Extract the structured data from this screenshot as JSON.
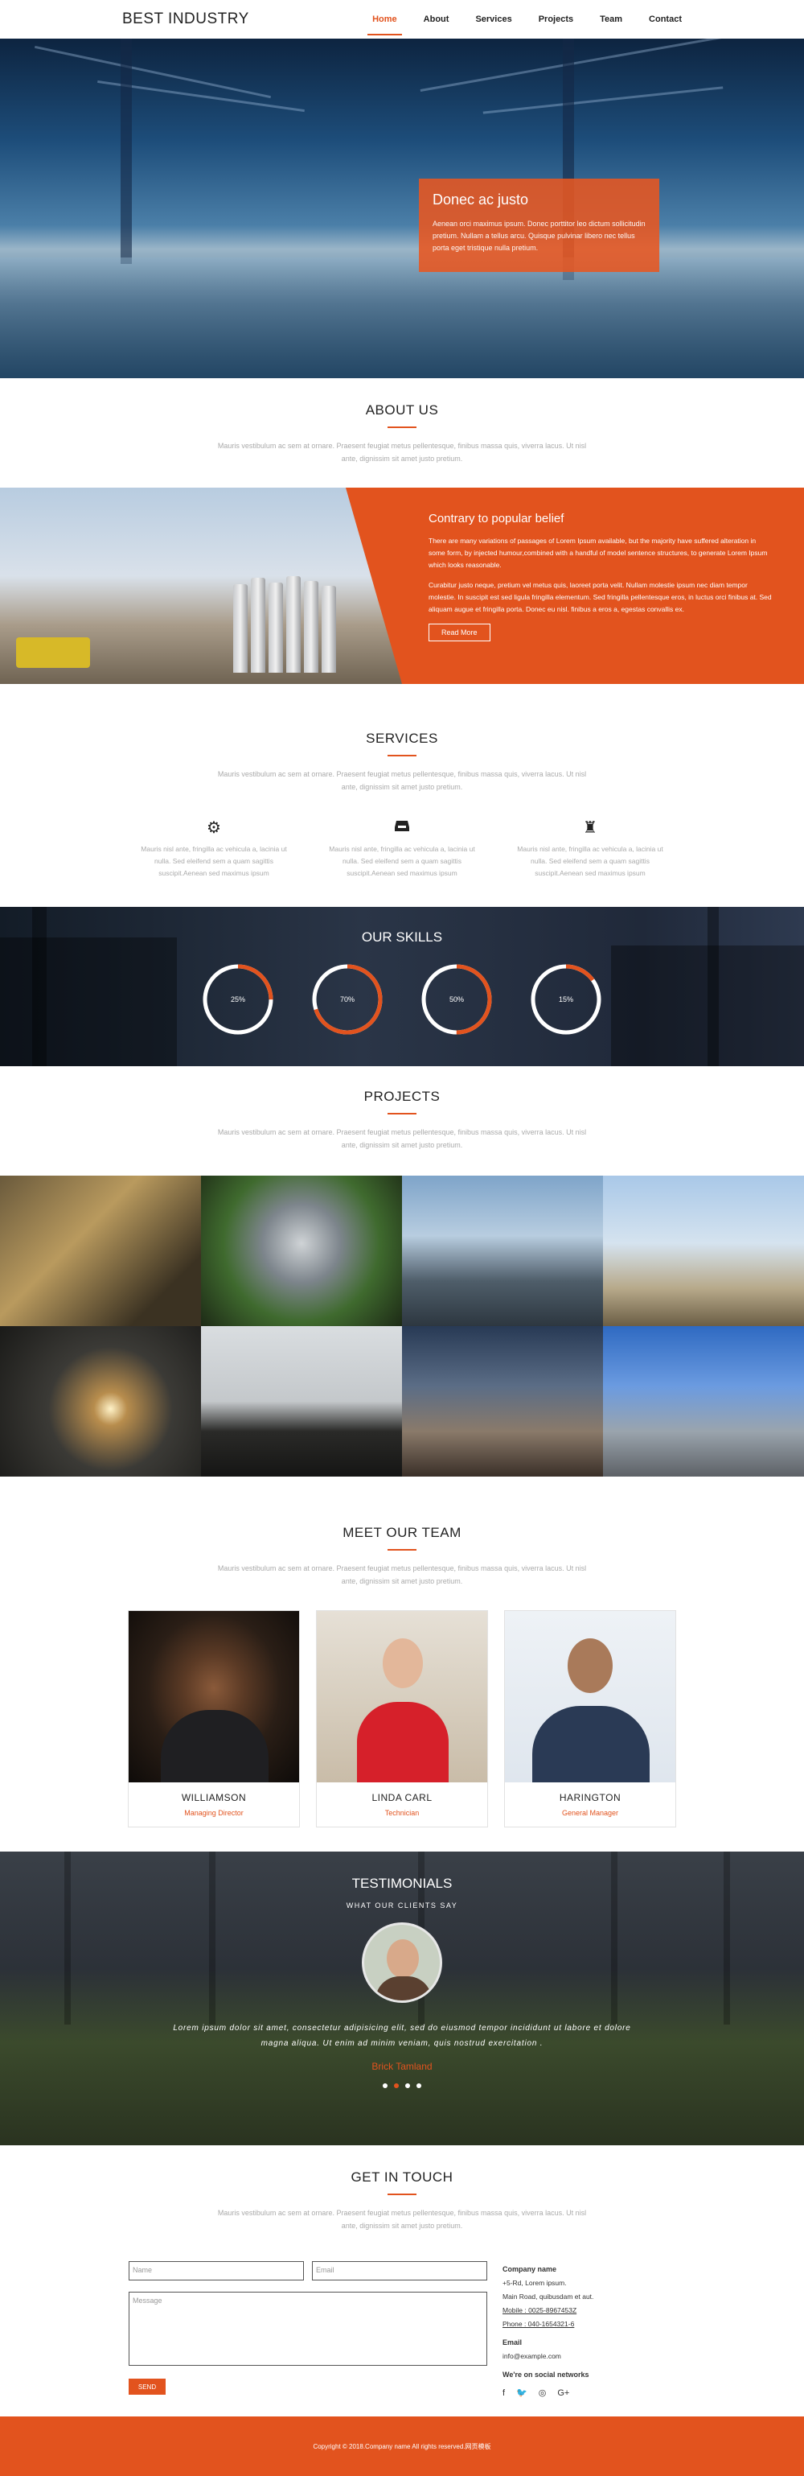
{
  "header": {
    "brand": "BEST INDUSTRY",
    "nav": [
      "Home",
      "About",
      "Services",
      "Projects",
      "Team",
      "Contact"
    ]
  },
  "hero": {
    "title": "Donec ac justo",
    "text": "Aenean orci maximus ipsum. Donec porttitor leo dictum sollicitudin pretium. Nullam a tellus arcu. Quisque pulvinar libero nec tellus porta eget tristique nulla pretium."
  },
  "about": {
    "title": "ABOUT US",
    "desc": "Mauris vestibulum ac sem at ornare. Praesent feugiat metus pellentesque, finibus massa quis, viverra lacus. Ut nisl ante, dignissim sit amet justo pretium."
  },
  "contrary": {
    "title": "Contrary to popular belief",
    "p1": "There are many variations of passages of Lorem Ipsum available, but the majority have suffered alteration in some form, by injected humour,combined with a handful of model sentence structures, to generate Lorem Ipsum which looks reasonable.",
    "p2": "Curabitur justo neque, pretium vel metus quis, laoreet porta velit. Nullam molestie ipsum nec diam tempor molestie. In suscipit est sed ligula fringilla elementum. Sed fringilla pellentesque eros, in luctus orci finibus at. Sed aliquam augue et fringilla porta. Donec eu nisl. finibus a eros a, egestas convallis ex.",
    "button": "Read More"
  },
  "services": {
    "title": "SERVICES",
    "desc": "Mauris vestibulum ac sem at ornare. Praesent feugiat metus pellentesque, finibus massa quis, viverra lacus. Ut nisl ante, dignissim sit amet justo pretium.",
    "items": [
      {
        "icon": "gear-icon",
        "text": "Mauris nisl ante, fringilla ac vehicula a, lacinia ut nulla. Sed eleifend sem a quam sagittis suscipit.Aenean sed maximus ipsum"
      },
      {
        "icon": "inbox-icon",
        "text": "Mauris nisl ante, fringilla ac vehicula a, lacinia ut nulla. Sed eleifend sem a quam sagittis suscipit.Aenean sed maximus ipsum"
      },
      {
        "icon": "chess-rook-icon",
        "text": "Mauris nisl ante, fringilla ac vehicula a, lacinia ut nulla. Sed eleifend sem a quam sagittis suscipit.Aenean sed maximus ipsum"
      }
    ]
  },
  "skills": {
    "title": "OUR SKILLS",
    "dials": [
      {
        "label": "25%",
        "value": 0.25
      },
      {
        "label": "70%",
        "value": 0.7
      },
      {
        "label": "50%",
        "value": 0.5
      },
      {
        "label": "15%",
        "value": 0.15
      }
    ]
  },
  "projects": {
    "title": "PROJECTS",
    "desc": "Mauris vestibulum ac sem at ornare. Praesent feugiat metus pellentesque, finibus massa quis, viverra lacus. Ut nisl ante, dignissim sit amet justo pretium."
  },
  "team": {
    "title": "MEET OUR TEAM",
    "desc": "Mauris vestibulum ac sem at ornare. Praesent feugiat metus pellentesque, finibus massa quis, viverra lacus. Ut nisl ante, dignissim sit amet justo pretium.",
    "members": [
      {
        "name": "WILLIAMSON",
        "role": "Managing Director"
      },
      {
        "name": "LINDA CARL",
        "role": "Technician"
      },
      {
        "name": "HARINGTON",
        "role": "General Manager"
      }
    ]
  },
  "testimonials": {
    "title": "TESTIMONIALS",
    "subtitle": "WHAT OUR CLIENTS SAY",
    "quote": "Lorem ipsum dolor sit amet, consectetur adipisicing elit, sed do eiusmod tempor incididunt ut labore et dolore magna aliqua. Ut enim ad minim veniam, quis nostrud exercitation .",
    "author": "Brick Tamland"
  },
  "contact": {
    "title": "GET IN TOUCH",
    "desc": "Mauris vestibulum ac sem at ornare. Praesent feugiat metus pellentesque, finibus massa quis, viverra lacus. Ut nisl ante, dignissim sit amet justo pretium.",
    "name_placeholder": "Name",
    "email_placeholder": "Email",
    "message_placeholder": "Message",
    "send": "SEND",
    "company_label": "Company name",
    "address1": "+5-Rd, Lorem ipsum.",
    "address2": "Main Road, quibusdam et aut.",
    "mobile": "Mobile : 0025-8967453Z",
    "phone": "Phone : 040-1654321-6",
    "email_label": "Email",
    "email": "info@example.com",
    "social_label": "We're on social networks",
    "social": [
      "facebook-icon",
      "twitter-icon",
      "dribbble-icon",
      "google-plus-icon"
    ]
  },
  "footer": {
    "text": "Copyright © 2018.Company name All rights reserved.网页模板"
  },
  "colors": {
    "accent": "#e2531e"
  }
}
